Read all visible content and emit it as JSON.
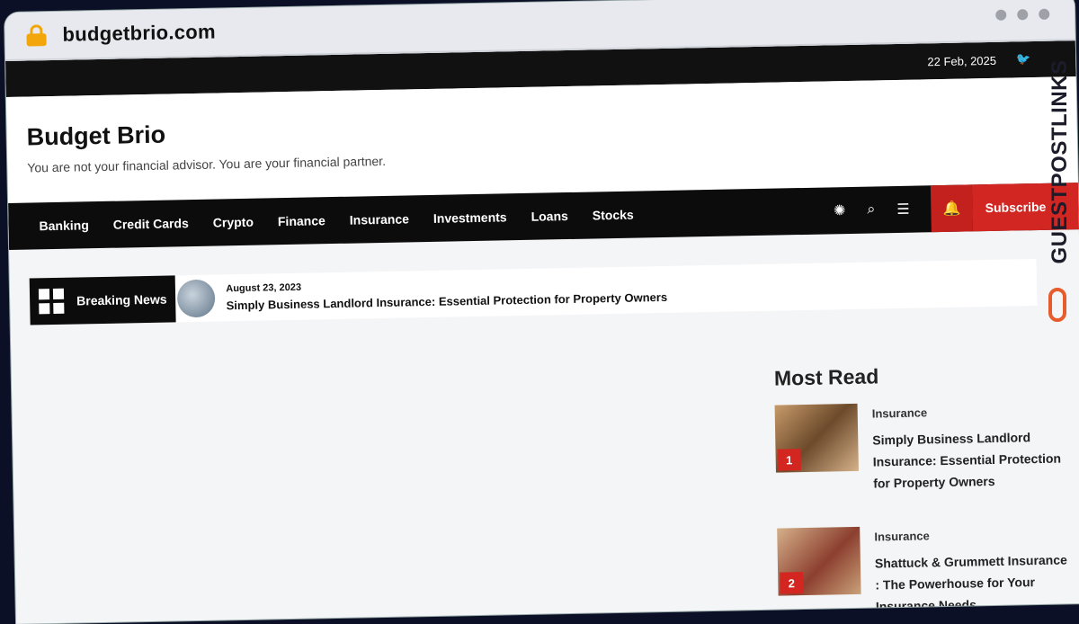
{
  "browser": {
    "url": "budgetbrio.com"
  },
  "topbar": {
    "date": "22 Feb, 2025"
  },
  "site": {
    "title": "Budget Brio",
    "tagline": "You are not your financial advisor. You are your financial partner."
  },
  "nav": {
    "items": [
      "Banking",
      "Credit Cards",
      "Crypto",
      "Finance",
      "Insurance",
      "Investments",
      "Loans",
      "Stocks"
    ],
    "subscribe": "Subscribe"
  },
  "breaking": {
    "label": "Breaking News",
    "date": "August 23, 2023",
    "title": "Simply Business Landlord Insurance: Essential Protection for Property Owners"
  },
  "most_read": {
    "heading": "Most Read",
    "items": [
      {
        "rank": "1",
        "category": "Insurance",
        "title": "Simply Business Landlord Insurance: Essential Protection for Property Owners"
      },
      {
        "rank": "2",
        "category": "Insurance",
        "title": "Shattuck & Grummett Insurance : The Powerhouse for Your Insurance Needs"
      }
    ]
  },
  "watermark": {
    "text": "GUESTPOSTLINKS"
  },
  "colors": {
    "accent": "#d12622",
    "navbar": "#0c0c0c",
    "lock": "#f2a60b"
  },
  "icons": [
    "lock-icon",
    "twitter-icon",
    "theme-toggle-icon",
    "search-icon",
    "menu-icon",
    "bell-icon",
    "grid-icon"
  ]
}
